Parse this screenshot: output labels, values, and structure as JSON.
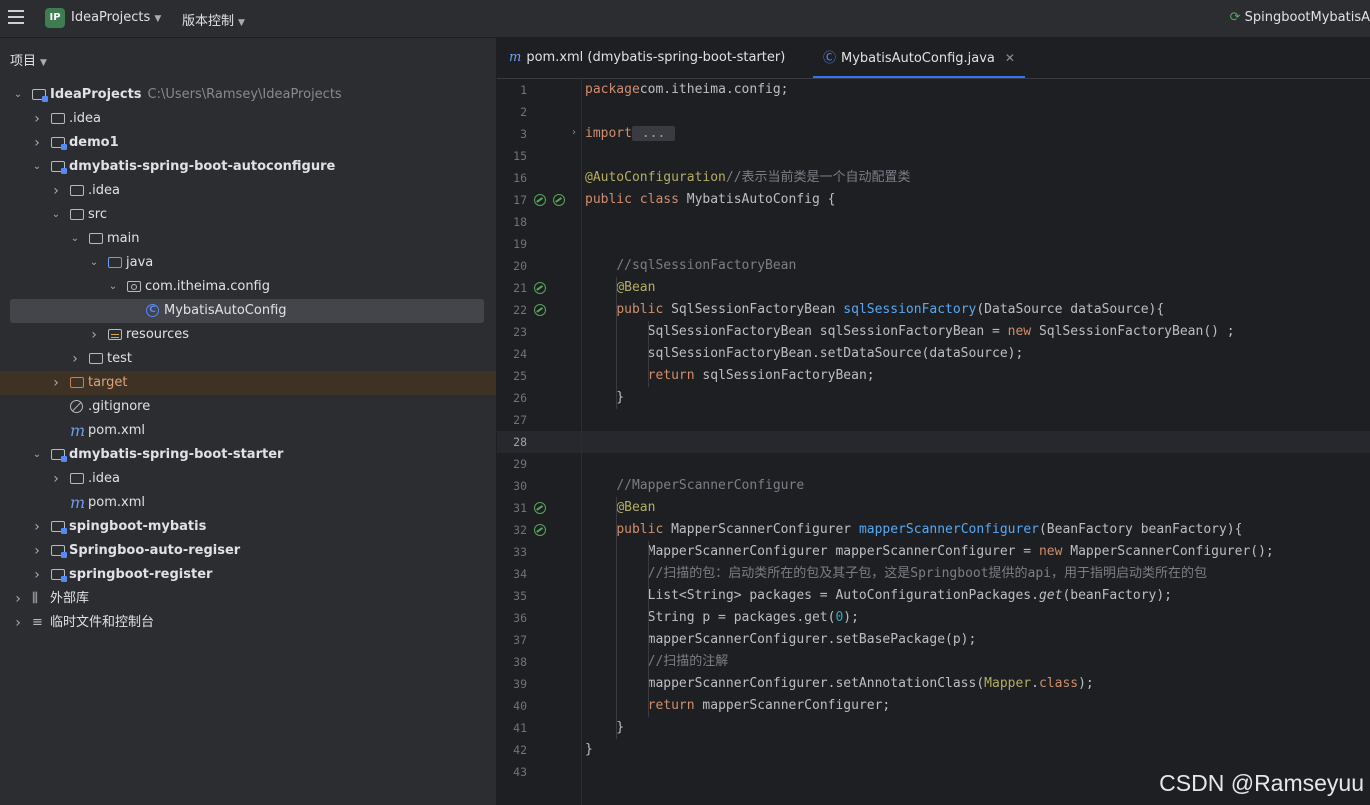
{
  "titlebar": {
    "project_badge": "IP",
    "project_name": "IdeaProjects",
    "vcs_menu": "版本控制",
    "run_config": "SpingbootMybatisA"
  },
  "sidebar": {
    "header": "项目",
    "tree": [
      {
        "label": "IdeaProjects",
        "path": "C:\\Users\\Ramsey\\IdeaProjects",
        "depth": 0,
        "expanded": true,
        "icon": "module-folder-icon",
        "bold": true
      },
      {
        "label": ".idea",
        "depth": 1,
        "expanded": false,
        "icon": "folder-icon"
      },
      {
        "label": "demo1",
        "depth": 1,
        "expanded": false,
        "icon": "module-folder-icon",
        "bold": true
      },
      {
        "label": "dmybatis-spring-boot-autoconfigure",
        "depth": 1,
        "expanded": true,
        "icon": "module-folder-icon",
        "bold": true
      },
      {
        "label": ".idea",
        "depth": 2,
        "expanded": false,
        "icon": "folder-icon"
      },
      {
        "label": "src",
        "depth": 2,
        "expanded": true,
        "icon": "folder-icon"
      },
      {
        "label": "main",
        "depth": 3,
        "expanded": true,
        "icon": "folder-icon"
      },
      {
        "label": "java",
        "depth": 4,
        "expanded": true,
        "icon": "source-folder-icon"
      },
      {
        "label": "com.itheima.config",
        "depth": 5,
        "expanded": true,
        "icon": "package-icon"
      },
      {
        "label": "MybatisAutoConfig",
        "depth": 6,
        "icon": "class-icon",
        "selected": true
      },
      {
        "label": "resources",
        "depth": 4,
        "expanded": false,
        "icon": "resources-folder-icon"
      },
      {
        "label": "test",
        "depth": 3,
        "expanded": false,
        "icon": "folder-icon"
      },
      {
        "label": "target",
        "depth": 2,
        "expanded": false,
        "icon": "excluded-folder-icon",
        "highlight": true
      },
      {
        "label": ".gitignore",
        "depth": 2,
        "icon": "ignore-file-icon"
      },
      {
        "label": "pom.xml",
        "depth": 2,
        "icon": "maven-icon"
      },
      {
        "label": "dmybatis-spring-boot-starter",
        "depth": 1,
        "expanded": true,
        "icon": "module-folder-icon",
        "bold": true
      },
      {
        "label": ".idea",
        "depth": 2,
        "expanded": false,
        "icon": "folder-icon"
      },
      {
        "label": "pom.xml",
        "depth": 2,
        "icon": "maven-icon"
      },
      {
        "label": "spingboot-mybatis",
        "depth": 1,
        "expanded": false,
        "icon": "module-folder-icon",
        "bold": true
      },
      {
        "label": "Springboo-auto-regiser",
        "depth": 1,
        "expanded": false,
        "icon": "module-folder-icon",
        "bold": true
      },
      {
        "label": "springboot-register",
        "depth": 1,
        "expanded": false,
        "icon": "module-folder-icon",
        "bold": true
      },
      {
        "label": "外部库",
        "depth": 0,
        "expanded": false,
        "icon": "library-icon"
      },
      {
        "label": "临时文件和控制台",
        "depth": 0,
        "expanded": false,
        "icon": "scratches-icon"
      }
    ]
  },
  "editor": {
    "tabs": [
      {
        "label": "pom.xml (dmybatis-spring-boot-starter)",
        "icon": "maven-icon",
        "active": false
      },
      {
        "label": "MybatisAutoConfig.java",
        "icon": "class-icon",
        "active": true
      }
    ],
    "line_numbers": [
      "1",
      "2",
      "3",
      "15",
      "16",
      "17",
      "18",
      "19",
      "20",
      "21",
      "22",
      "23",
      "24",
      "25",
      "26",
      "27",
      "28",
      "29",
      "30",
      "31",
      "32",
      "33",
      "34",
      "35",
      "36",
      "37",
      "38",
      "39",
      "40",
      "41",
      "42",
      "43"
    ],
    "current_line": "28",
    "gutter_icons": [
      {
        "line": "17",
        "name": "spring-bean-icon"
      },
      {
        "line": "21",
        "name": "spring-bean-icon"
      },
      {
        "line": "22",
        "name": "spring-bean-icon"
      },
      {
        "line": "31",
        "name": "spring-bean-icon"
      },
      {
        "line": "32",
        "name": "spring-bean-icon"
      }
    ],
    "code_lines": [
      [
        [
          "kw",
          "package"
        ],
        [
          "",
          "com.itheima.config;"
        ]
      ],
      [],
      [
        [
          "kw",
          "import"
        ],
        [
          "",
          ""
        ],
        [
          "fold",
          " ... "
        ]
      ],
      [],
      [
        [
          "ann",
          "@AutoConfiguration"
        ],
        [
          "cm",
          "//表示当前类是一个自动配置类"
        ]
      ],
      [
        [
          "kw",
          "public class "
        ],
        [
          "",
          "MybatisAutoConfig {"
        ]
      ],
      [],
      [],
      [
        [
          "",
          "    "
        ],
        [
          "cm",
          "//sqlSessionFactoryBean"
        ]
      ],
      [
        [
          "",
          "    "
        ],
        [
          "ann",
          "@Bean"
        ]
      ],
      [
        [
          "",
          "    "
        ],
        [
          "kw",
          "public "
        ],
        [
          "",
          "SqlSessionFactoryBean "
        ],
        [
          "fn",
          "sqlSessionFactory"
        ],
        [
          "",
          "(DataSource dataSource){"
        ]
      ],
      [
        [
          "",
          "        SqlSessionFactoryBean sqlSessionFactoryBean = "
        ],
        [
          "kw",
          "new "
        ],
        [
          "",
          "SqlSessionFactoryBean() ;"
        ]
      ],
      [
        [
          "",
          "        sqlSessionFactoryBean.setDataSource(dataSource);"
        ]
      ],
      [
        [
          "",
          "        "
        ],
        [
          "kw",
          "return "
        ],
        [
          "",
          "sqlSessionFactoryBean;"
        ]
      ],
      [
        [
          "",
          "    }"
        ]
      ],
      [],
      [],
      [],
      [
        [
          "",
          "    "
        ],
        [
          "cm",
          "//MapperScannerConfigure"
        ]
      ],
      [
        [
          "",
          "    "
        ],
        [
          "ann",
          "@Bean"
        ]
      ],
      [
        [
          "",
          "    "
        ],
        [
          "kw",
          "public "
        ],
        [
          "",
          "MapperScannerConfigurer "
        ],
        [
          "fn",
          "mapperScannerConfigurer"
        ],
        [
          "",
          "(BeanFactory beanFactory){"
        ]
      ],
      [
        [
          "",
          "        MapperScannerConfigurer mapperScannerConfigurer = "
        ],
        [
          "kw",
          "new "
        ],
        [
          "",
          "MapperScannerConfigurer();"
        ]
      ],
      [
        [
          "",
          "        "
        ],
        [
          "cm",
          "//扫描的包：启动类所在的包及其子包，这是Springboot提供的api，用于指明启动类所在的包"
        ]
      ],
      [
        [
          "",
          "        List<String> packages = AutoConfigurationPackages."
        ],
        [
          "it",
          "get"
        ],
        [
          "",
          "(beanFactory);"
        ]
      ],
      [
        [
          "",
          "        String p = packages.get("
        ],
        [
          "num",
          "0"
        ],
        [
          "",
          ");"
        ]
      ],
      [
        [
          "",
          "        mapperScannerConfigurer.setBasePackage(p);"
        ]
      ],
      [
        [
          "",
          "        "
        ],
        [
          "cm",
          "//扫描的注解"
        ]
      ],
      [
        [
          "",
          "        mapperScannerConfigurer.setAnnotationClass("
        ],
        [
          "ann",
          "Mapper"
        ],
        [
          "",
          "."
        ],
        [
          "kw",
          "class"
        ],
        [
          "",
          ");"
        ]
      ],
      [
        [
          "",
          "        "
        ],
        [
          "kw",
          "return "
        ],
        [
          "",
          "mapperScannerConfigurer;"
        ]
      ],
      [
        [
          "",
          "    }"
        ]
      ],
      [
        [
          "",
          "}"
        ]
      ],
      []
    ]
  },
  "watermark": "CSDN @Ramseyuu"
}
